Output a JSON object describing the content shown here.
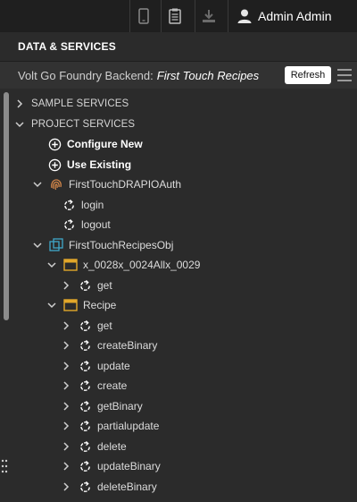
{
  "topbar": {
    "user_name": "Admin Admin",
    "icons": [
      "mobile-icon",
      "clipboard-icon",
      "download-icon",
      "user-icon"
    ]
  },
  "panel": {
    "title": "DATA & SERVICES",
    "backend_label": "Volt Go Foundry Backend:",
    "backend_name": "First Touch Recipes",
    "refresh_label": "Refresh"
  },
  "tree": {
    "sample_services": "SAMPLE SERVICES",
    "project_services": "PROJECT SERVICES",
    "configure_new": "Configure New",
    "use_existing": "Use Existing",
    "auth_service": {
      "name": "FirstTouchDRAPIOAuth",
      "operations": [
        "login",
        "logout"
      ]
    },
    "object_service": {
      "name": "FirstTouchRecipesObj",
      "objects": [
        {
          "name": "x_0028x_0024Allx_0029",
          "operations": [
            "get"
          ]
        },
        {
          "name": "Recipe",
          "operations": [
            "get",
            "createBinary",
            "update",
            "create",
            "getBinary",
            "partialupdate",
            "delete",
            "updateBinary",
            "deleteBinary"
          ]
        }
      ]
    }
  },
  "colors": {
    "background": "#2b2b2b",
    "topbar": "#1f1f1f",
    "auth_icon": "#d4874a",
    "object_icon": "#3fa7c9",
    "table_icon": "#e2a72a"
  }
}
